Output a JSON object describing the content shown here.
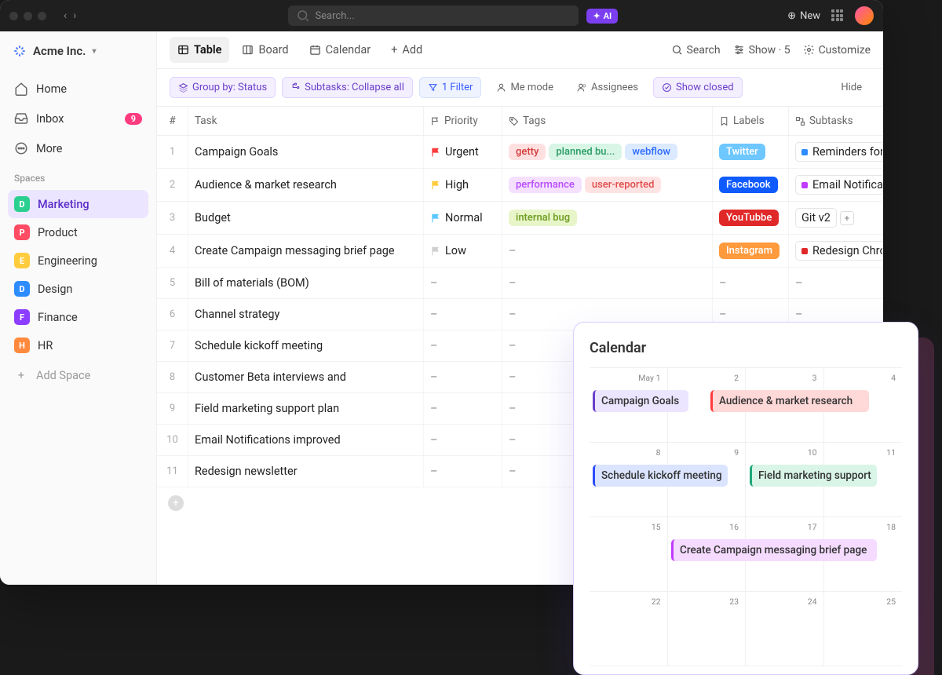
{
  "topbar": {
    "search_placeholder": "Search...",
    "ai_label": "AI",
    "new_label": "New"
  },
  "org": {
    "name": "Acme Inc."
  },
  "sidebar": {
    "items": [
      {
        "label": "Home"
      },
      {
        "label": "Inbox",
        "badge": "9"
      },
      {
        "label": "More"
      }
    ],
    "spaces_label": "Spaces",
    "spaces": [
      {
        "letter": "D",
        "label": "Marketing",
        "color": "#2bcf8f",
        "active": true
      },
      {
        "letter": "P",
        "label": "Product",
        "color": "#ff4b63"
      },
      {
        "letter": "E",
        "label": "Engineering",
        "color": "#ffcc3d"
      },
      {
        "letter": "D",
        "label": "Design",
        "color": "#2d8cff"
      },
      {
        "letter": "F",
        "label": "Finance",
        "color": "#8c3dff"
      },
      {
        "letter": "H",
        "label": "HR",
        "color": "#ff8a3d"
      }
    ],
    "add_space": "Add Space"
  },
  "tabs": {
    "items": [
      {
        "label": "Table"
      },
      {
        "label": "Board"
      },
      {
        "label": "Calendar"
      },
      {
        "label": "Add"
      }
    ],
    "right": {
      "search": "Search",
      "show": "Show · 5",
      "customize": "Customize"
    }
  },
  "filters": {
    "group": "Group by: Status",
    "subtasks": "Subtasks: Collapse all",
    "filter": "1 Filter",
    "me": "Me mode",
    "assignees": "Assignees",
    "closed": "Show closed",
    "hide": "Hide"
  },
  "columns": [
    "#",
    "Task",
    "Priority",
    "Tags",
    "Labels",
    "Subtasks"
  ],
  "rows": [
    {
      "num": "1",
      "task": "Campaign Goals",
      "priority": {
        "label": "Urgent",
        "color": "#ff3b3b"
      },
      "tags": [
        {
          "text": "getty",
          "bg": "#ffe0e0",
          "fg": "#d43b3b"
        },
        {
          "text": "planned bu...",
          "bg": "#d9f5e5",
          "fg": "#2a9d66"
        },
        {
          "text": "webflow",
          "bg": "#dbeaff",
          "fg": "#2d6bff"
        }
      ],
      "label": {
        "text": "Twitter",
        "bg": "#6ec7ff",
        "fg": "#fff"
      },
      "subtask": {
        "text": "Reminders for",
        "dot": "#2d8cff"
      }
    },
    {
      "num": "2",
      "task": "Audience & market research",
      "priority": {
        "label": "High",
        "color": "#ffcc3d"
      },
      "tags": [
        {
          "text": "performance",
          "bg": "#f5e0ff",
          "fg": "#b84bff"
        },
        {
          "text": "user-reported",
          "bg": "#ffe3e3",
          "fg": "#e04b4b"
        }
      ],
      "label": {
        "text": "Facebook",
        "bg": "#0f5bff",
        "fg": "#fff"
      },
      "subtask": {
        "text": "Email Notificat",
        "dot": "#c03bff"
      }
    },
    {
      "num": "3",
      "task": "Budget",
      "priority": {
        "label": "Normal",
        "color": "#5ac8ff"
      },
      "tags": [
        {
          "text": "internal bug",
          "bg": "#e8f5c8",
          "fg": "#6c9c1f"
        }
      ],
      "label": {
        "text": "YouTubbe",
        "bg": "#e02828",
        "fg": "#fff"
      },
      "subtask": {
        "text": "Git v2",
        "plus": true
      }
    },
    {
      "num": "4",
      "task": "Create Campaign messaging brief page",
      "priority": {
        "label": "Low",
        "color": "#cfcfcf"
      },
      "tags": [
        {
          "text": "–"
        }
      ],
      "label": {
        "text": "Instagram",
        "bg": "#ff9a3d",
        "fg": "#fff"
      },
      "subtask": {
        "text": "Redesign Chro",
        "dot": "#e02828"
      }
    },
    {
      "num": "5",
      "task": "Bill of materials (BOM)"
    },
    {
      "num": "6",
      "task": "Channel strategy"
    },
    {
      "num": "7",
      "task": "Schedule kickoff meeting"
    },
    {
      "num": "8",
      "task": "Customer Beta interviews and"
    },
    {
      "num": "9",
      "task": "Field marketing support plan"
    },
    {
      "num": "10",
      "task": "Email Notifications improved"
    },
    {
      "num": "11",
      "task": "Redesign newsletter"
    }
  ],
  "calendar": {
    "title": "Calendar",
    "dates": [
      "May 1",
      "2",
      "3",
      "4",
      "8",
      "9",
      "10",
      "11",
      "15",
      "16",
      "17",
      "18",
      "22",
      "23",
      "24",
      "25"
    ],
    "events": [
      {
        "text": "Campaign Goals",
        "bg": "#ece5ff",
        "border": "#6b3fc9",
        "row": 0,
        "col": 0,
        "span": 1.3
      },
      {
        "text": "Audience & market research",
        "bg": "#ffd8d8",
        "border": "#ff3b3b",
        "row": 0,
        "col": 1.5,
        "span": 2.1
      },
      {
        "text": "Schedule kickoff meeting",
        "bg": "#dbe4ff",
        "border": "#2d4bff",
        "row": 1,
        "col": 0,
        "span": 1.8
      },
      {
        "text": "Field marketing support",
        "bg": "#d9f5e8",
        "border": "#1fa87a",
        "row": 1,
        "col": 2,
        "span": 1.7
      },
      {
        "text": "Create Campaign messaging brief page",
        "bg": "#f5dbff",
        "border": "#c03bff",
        "row": 2,
        "col": 1,
        "span": 2.7
      }
    ]
  }
}
